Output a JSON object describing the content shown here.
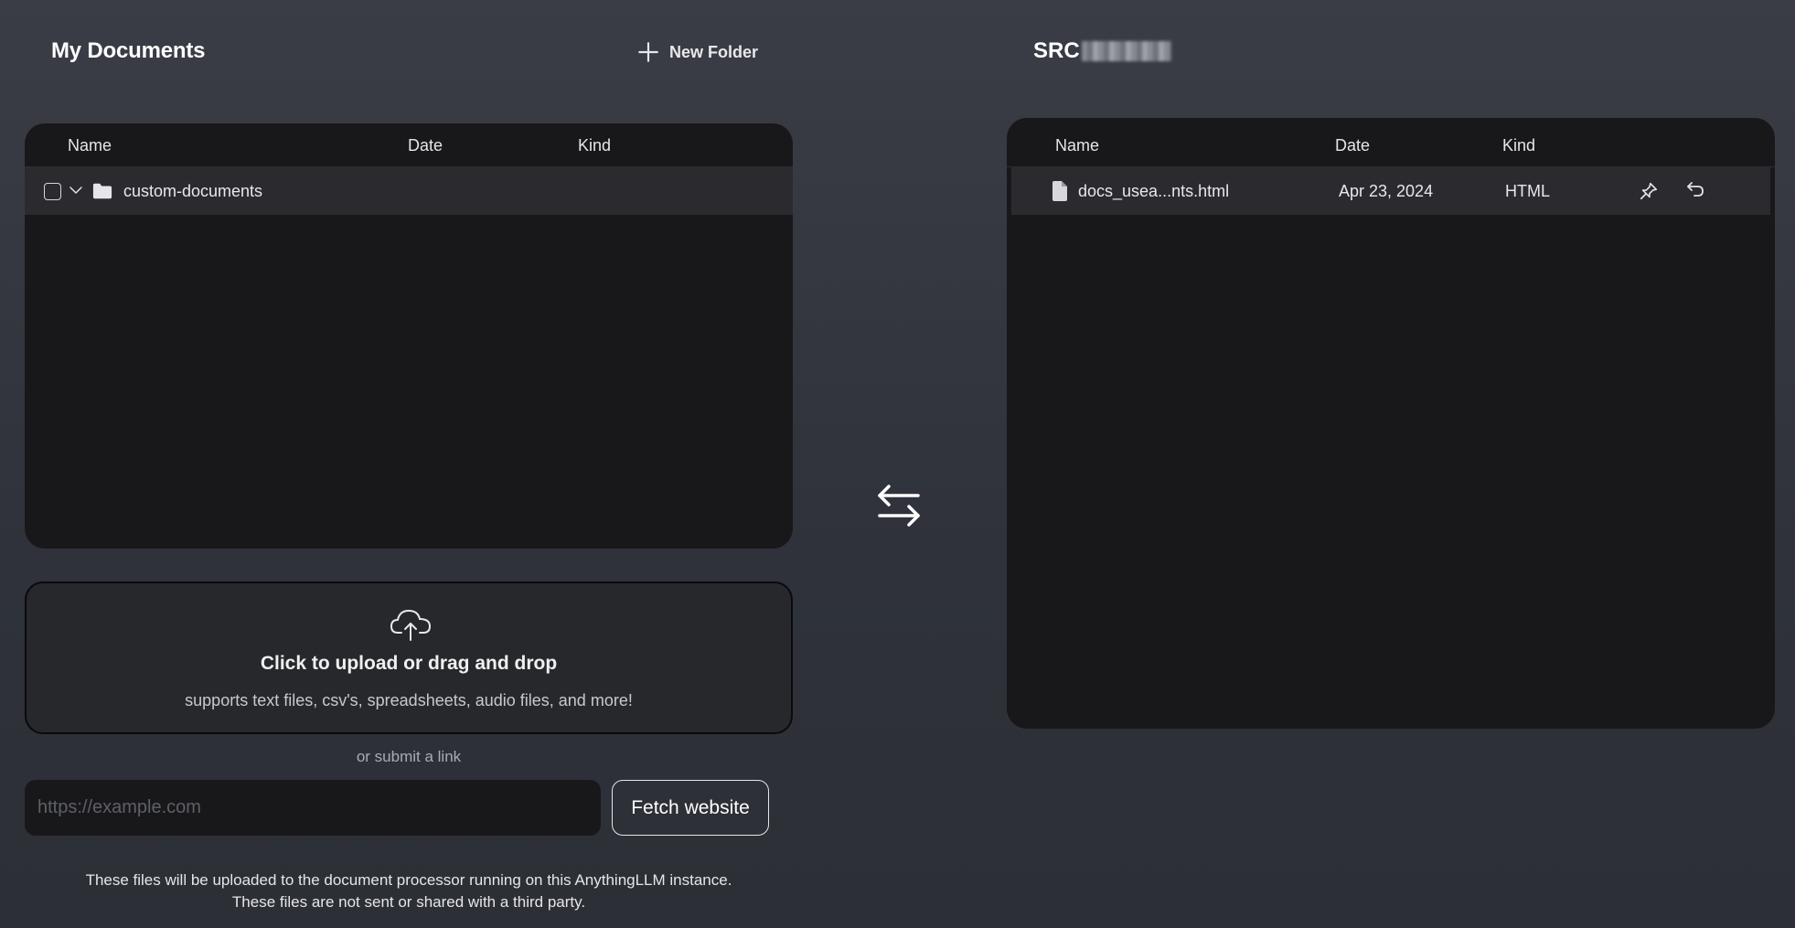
{
  "left": {
    "title": "My Documents",
    "new_folder_label": "New Folder",
    "columns": [
      "Name",
      "Date",
      "Kind"
    ],
    "rows": [
      {
        "name": "custom-documents",
        "type": "folder",
        "expanded": true,
        "checked": false
      }
    ]
  },
  "right": {
    "title_visible": "SRC",
    "title_redacted": true,
    "columns": [
      "Name",
      "Date",
      "Kind"
    ],
    "rows": [
      {
        "name": "docs_usea...nts.html",
        "date": "Apr 23, 2024",
        "kind": "HTML"
      }
    ]
  },
  "upload": {
    "title": "Click to upload or drag and drop",
    "subtitle": "supports text files, csv's, spreadsheets, audio files, and more!",
    "or_link": "or submit a link",
    "url_placeholder": "https://example.com",
    "url_value": "",
    "fetch_label": "Fetch website",
    "footnote_line1": "These files will be uploaded to the document processor running on this AnythingLLM instance.",
    "footnote_line2": "These files are not sent or shared with a third party."
  },
  "icons": {
    "new_folder": "plus-icon",
    "expand": "chevron-down-icon",
    "folder": "folder-icon",
    "file": "file-icon",
    "pin": "pin-icon",
    "restore": "undo-icon",
    "swap": "swap-arrows-icon",
    "upload": "cloud-upload-icon"
  },
  "colors": {
    "background": "#34373f",
    "panel": "#18181b",
    "row_highlight": "#2b2b2f",
    "dropzone": "#27282c",
    "text": "#ffffff"
  }
}
